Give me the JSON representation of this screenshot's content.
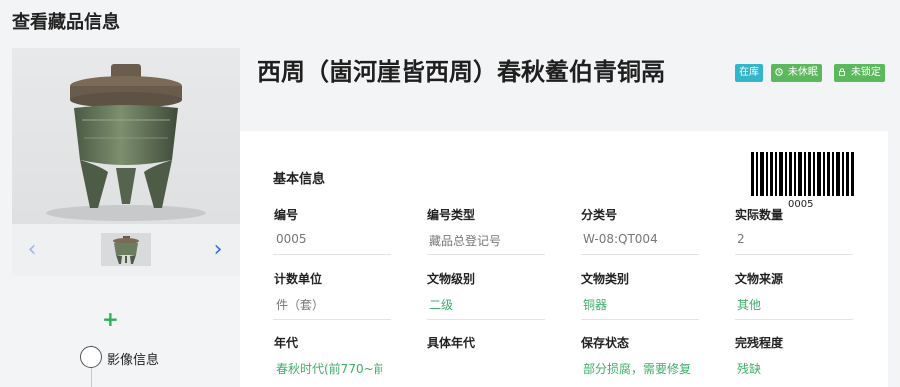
{
  "page": {
    "title": "查看藏品信息"
  },
  "gallery": {
    "prev_arrow": "‹",
    "next_arrow": "›",
    "add_symbol": "+",
    "timeline_label": "影像信息"
  },
  "relic": {
    "title": "西周（崮河崖皆西周）春秋鲝伯青铜鬲",
    "badges": [
      {
        "label": "在库",
        "icon": "",
        "color": "#33b6c9"
      },
      {
        "label": "未休眠",
        "icon": "clock-icon",
        "color": "#5cb85c"
      },
      {
        "label": "未锁定",
        "icon": "lock-icon",
        "color": "#5cb85c"
      }
    ]
  },
  "info": {
    "section_title": "基本信息",
    "barcode_number": "0005",
    "fields": [
      {
        "label": "编号",
        "value": "0005"
      },
      {
        "label": "编号类型",
        "value": "藏品总登记号"
      },
      {
        "label": "分类号",
        "value": "W-08:QT004"
      },
      {
        "label": "实际数量",
        "value": "2"
      },
      {
        "label": "计数单位",
        "value": "件（套）"
      },
      {
        "label": "文物级别",
        "value": "二级"
      },
      {
        "label": "文物类别",
        "value": "铜器"
      },
      {
        "label": "文物来源",
        "value": "其他"
      },
      {
        "label": "年代",
        "value": "春秋时代(前770~前"
      },
      {
        "label": "具体年代",
        "value": ""
      },
      {
        "label": "保存状态",
        "value": "部分损腐，需要修复"
      },
      {
        "label": "完残程度",
        "value": "残缺"
      }
    ]
  }
}
